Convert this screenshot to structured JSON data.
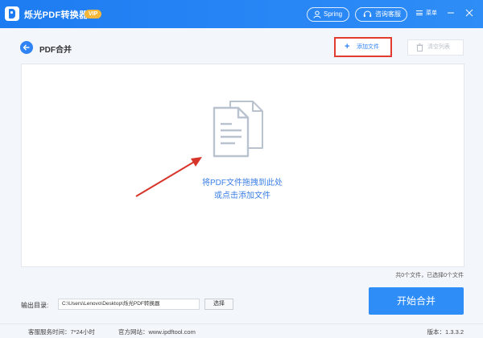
{
  "titlebar": {
    "app_name": "烁光PDF转换器",
    "vip_badge": "VIP",
    "username": "Spring",
    "service_label": "咨询客服",
    "menu_label": "菜单"
  },
  "header": {
    "page_title": "PDF合并",
    "add_file_label": "添加文件",
    "clear_list_label": "清空列表"
  },
  "drop_zone": {
    "line1": "将PDF文件拖拽到此处",
    "line2": "或点击添加文件"
  },
  "file_count_text": "共0个文件，已选择0个文件",
  "output": {
    "label": "输出目录:",
    "path": "C:\\Users\\Lenovo\\Desktop\\烁光PDF转换器",
    "choose_label": "选择"
  },
  "start_merge_label": "开始合并",
  "footer": {
    "service_hours": "客服服务时间：7*24小时",
    "official_site": "官方网站：www.ipdftool.com",
    "version": "版本：1.3.3.2"
  },
  "colors": {
    "primary": "#2f8df7",
    "vip": "#f4b73a",
    "highlight_border": "#e23b2f",
    "annotation_arrow": "#d8352a"
  }
}
